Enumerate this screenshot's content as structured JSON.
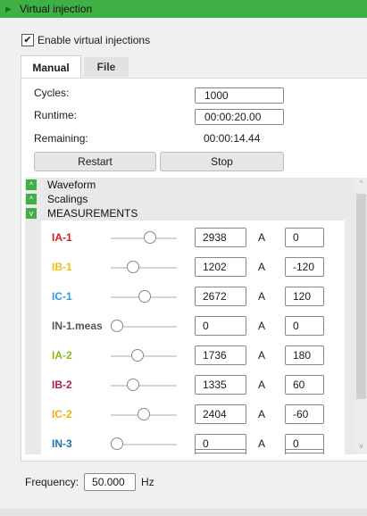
{
  "header": {
    "title": "Virtual injection"
  },
  "enable": {
    "label": "Enable virtual injections",
    "checked": true
  },
  "tabs": [
    {
      "label": "Manual"
    },
    {
      "label": "File"
    }
  ],
  "manual": {
    "cycles_label": "Cycles:",
    "cycles_value": "1000",
    "runtime_label": "Runtime:",
    "runtime_value": "00:00:20.00",
    "remaining_label": "Remaining:",
    "remaining_value": "00:00:14.44",
    "restart_label": "Restart",
    "stop_label": "Stop"
  },
  "sections": [
    {
      "label": "Waveform"
    },
    {
      "label": "Scalings"
    },
    {
      "label": "MEASUREMENTS"
    }
  ],
  "measurements": [
    {
      "name": "IA-1",
      "color": "#cc1f1f",
      "slider": 0.62,
      "value": "2938",
      "unit": "A",
      "angle": "0"
    },
    {
      "name": "IB-1",
      "color": "#e8c20f",
      "slider": 0.3,
      "value": "1202",
      "unit": "A",
      "angle": "-120"
    },
    {
      "name": "IC-1",
      "color": "#2b9ad6",
      "slider": 0.52,
      "value": "2672",
      "unit": "A",
      "angle": "120"
    },
    {
      "name": "IN-1.meas",
      "color": "#555555",
      "slider": 0.0,
      "value": "0",
      "unit": "A",
      "angle": "0"
    },
    {
      "name": "IA-2",
      "color": "#7fbf1e",
      "slider": 0.38,
      "value": "1736",
      "unit": "A",
      "angle": "180"
    },
    {
      "name": "IB-2",
      "color": "#b0204a",
      "slider": 0.3,
      "value": "1335",
      "unit": "A",
      "angle": "60"
    },
    {
      "name": "IC-2",
      "color": "#e8b20f",
      "slider": 0.5,
      "value": "2404",
      "unit": "A",
      "angle": "-60"
    },
    {
      "name": "IN-3",
      "color": "#1f6fa8",
      "slider": 0.0,
      "value": "0",
      "unit": "A",
      "angle": "0"
    }
  ],
  "frequency": {
    "label": "Frequency:",
    "value": "50.000",
    "unit": "Hz"
  },
  "icons": {
    "collapse": "chevron-up-icon",
    "expand": "chevron-down-icon",
    "header": "triangle-right-icon"
  }
}
